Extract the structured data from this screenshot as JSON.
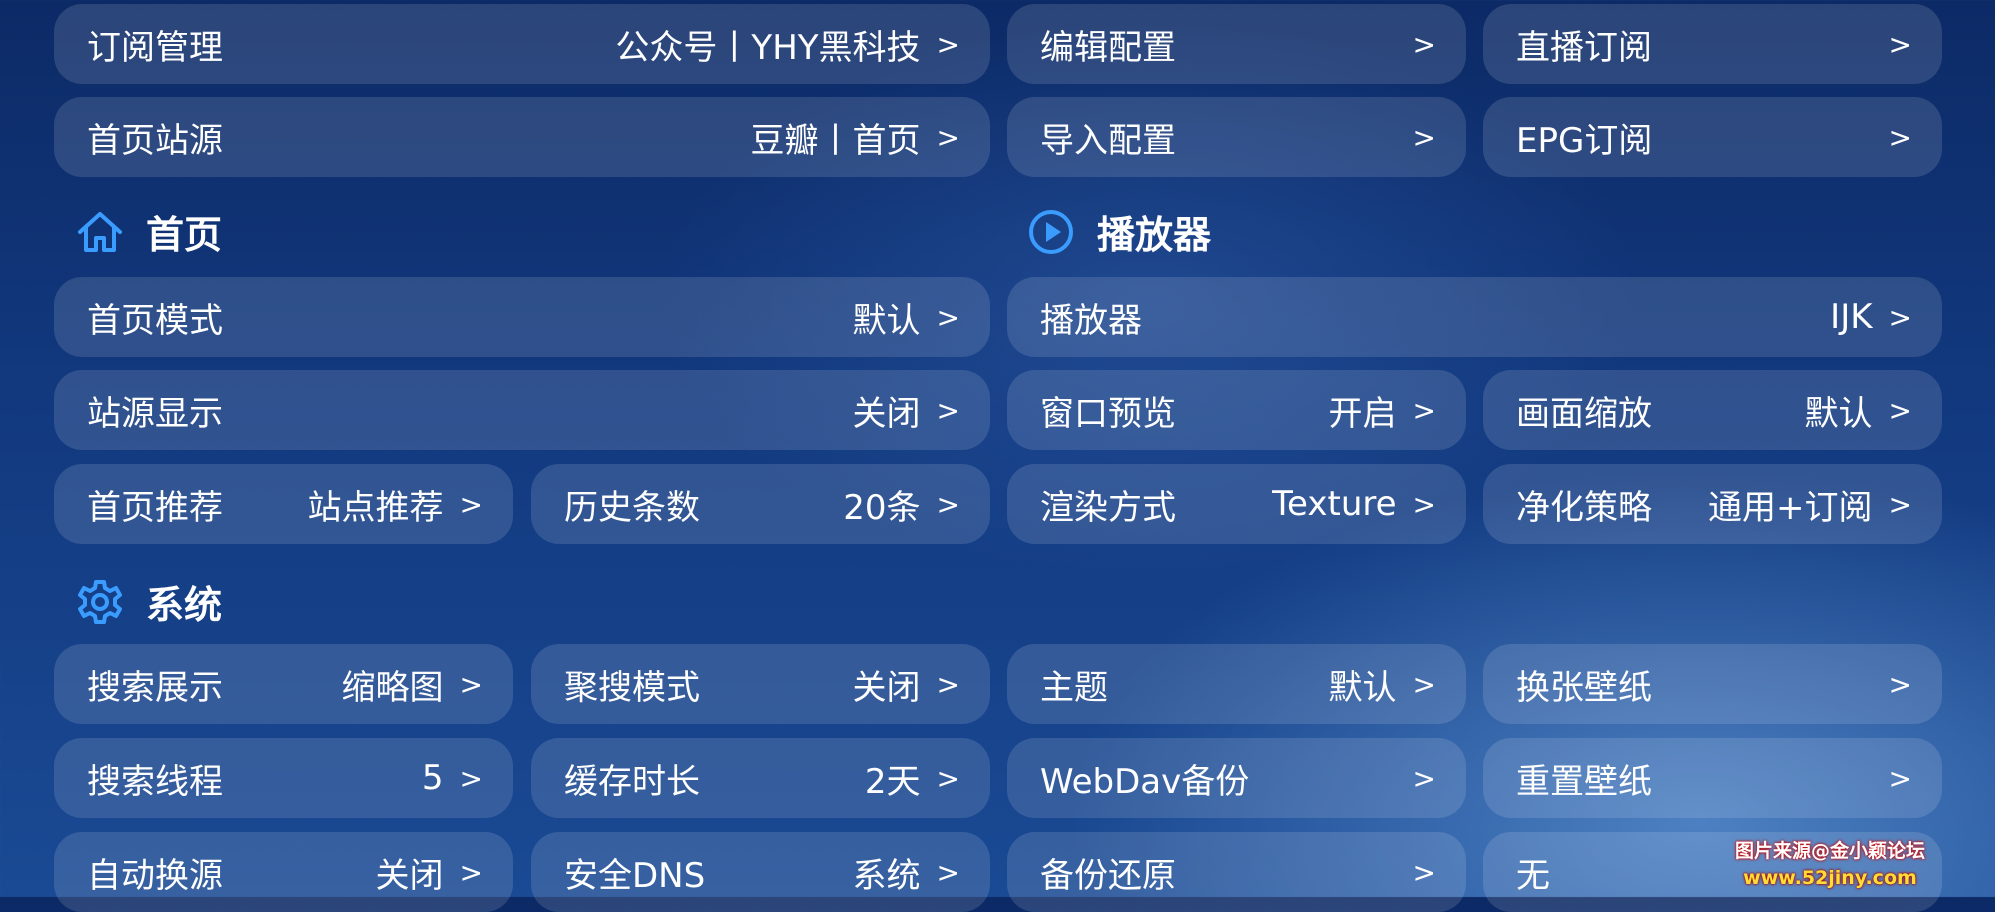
{
  "sections": {
    "home": "首页",
    "player": "播放器",
    "system": "系统"
  },
  "chevron": ">",
  "tiles": {
    "subscription": {
      "label": "订阅管理",
      "value": "公众号丨YHY黑科技"
    },
    "edit_config": {
      "label": "编辑配置",
      "value": ""
    },
    "live_sub": {
      "label": "直播订阅",
      "value": ""
    },
    "home_source": {
      "label": "首页站源",
      "value": "豆瓣丨首页"
    },
    "import_config": {
      "label": "导入配置",
      "value": ""
    },
    "epg_sub": {
      "label": "EPG订阅",
      "value": ""
    },
    "home_mode": {
      "label": "首页模式",
      "value": "默认"
    },
    "player": {
      "label": "播放器",
      "value": "IJK"
    },
    "source_display": {
      "label": "站源显示",
      "value": "关闭"
    },
    "window_preview": {
      "label": "窗口预览",
      "value": "开启"
    },
    "scale": {
      "label": "画面缩放",
      "value": "默认"
    },
    "home_recommend": {
      "label": "首页推荐",
      "value": "站点推荐"
    },
    "history_count": {
      "label": "历史条数",
      "value": "20条"
    },
    "render_mode": {
      "label": "渲染方式",
      "value": "Texture"
    },
    "purify": {
      "label": "净化策略",
      "value": "通用+订阅"
    },
    "search_display": {
      "label": "搜索展示",
      "value": "缩略图"
    },
    "aggregate_search": {
      "label": "聚搜模式",
      "value": "关闭"
    },
    "theme": {
      "label": "主题",
      "value": "默认"
    },
    "change_wallpaper": {
      "label": "换张壁纸",
      "value": ""
    },
    "search_threads": {
      "label": "搜索线程",
      "value": "5"
    },
    "cache_duration": {
      "label": "缓存时长",
      "value": "2天"
    },
    "webdav_backup": {
      "label": "WebDav备份",
      "value": ""
    },
    "reset_wallpaper": {
      "label": "重置壁纸",
      "value": ""
    },
    "auto_switch": {
      "label": "自动换源",
      "value": "关闭"
    },
    "secure_dns": {
      "label": "安全DNS",
      "value": "系统"
    },
    "backup_restore": {
      "label": "备份还原",
      "value": ""
    },
    "none_item": {
      "label": "无",
      "value": ""
    }
  },
  "watermark": {
    "line1": "图片来源@金小颖论坛",
    "line2": "www.52jiny.com"
  },
  "colors": {
    "accent_icon": "#3b9cff",
    "tile_bg": "rgba(255,255,255,0.13)"
  }
}
